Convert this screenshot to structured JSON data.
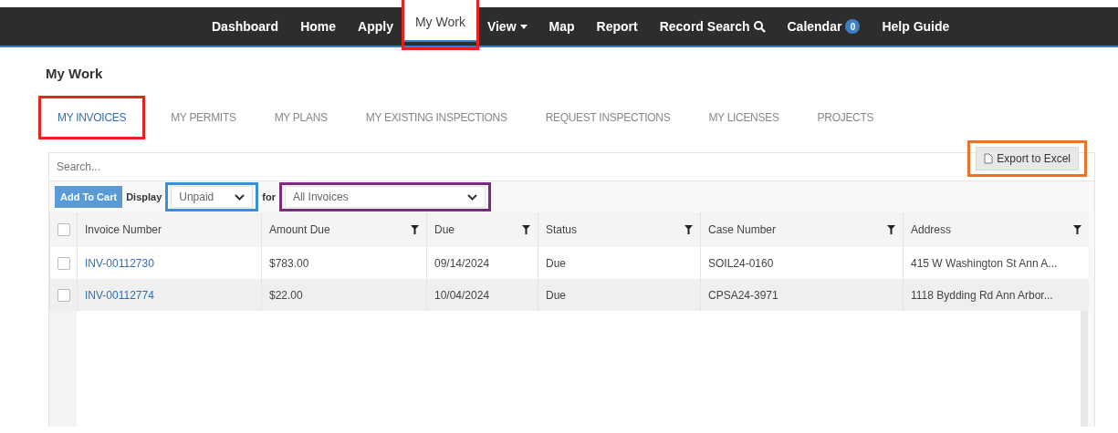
{
  "nav": [
    {
      "label": "Dashboard",
      "selected": false
    },
    {
      "label": "Home",
      "selected": false
    },
    {
      "label": "Apply",
      "selected": false
    },
    {
      "label": "My Work",
      "selected": true,
      "color": "#e8231d"
    },
    {
      "label": "View",
      "selected": false,
      "kind": "dropdown"
    },
    {
      "label": "Map",
      "selected": false
    },
    {
      "label": "Report",
      "selected": false
    },
    {
      "label": "Record Search",
      "selected": false,
      "kind": "search"
    },
    {
      "label": "Calendar",
      "selected": false,
      "kind": "badge",
      "badge": "0"
    },
    {
      "label": "Help Guide",
      "selected": false
    }
  ],
  "page_title": "My Work",
  "tabs": [
    {
      "label": "MY INVOICES",
      "selected": true,
      "color": "#e8231d"
    },
    {
      "label": "MY PERMITS",
      "selected": false
    },
    {
      "label": "MY PLANS",
      "selected": false
    },
    {
      "label": "MY EXISTING INSPECTIONS",
      "selected": false
    },
    {
      "label": "REQUEST INSPECTIONS",
      "selected": false
    },
    {
      "label": "MY LICENSES",
      "selected": false
    },
    {
      "label": "PROJECTS",
      "selected": false
    }
  ],
  "search": {
    "placeholder": "Search..."
  },
  "export_button": {
    "label": "Export to Excel",
    "color": "#e8732b"
  },
  "add_to_cart": "Add To Cart",
  "display_label": "Display",
  "display_select": {
    "value": "Unpaid",
    "color": "#3a8fd9"
  },
  "for_label": "for",
  "for_select": {
    "value": "All Invoices",
    "color": "#7b2a7e"
  },
  "table": {
    "select_all": {
      "checked": false
    },
    "columns": [
      {
        "label": "Invoice Number",
        "filter": false
      },
      {
        "label": "Amount Due",
        "filter": true
      },
      {
        "label": "Due",
        "filter": true
      },
      {
        "label": "Status",
        "filter": true
      },
      {
        "label": "Case Number",
        "filter": true
      },
      {
        "label": "Address",
        "filter": true
      }
    ],
    "rows": [
      {
        "checked": false,
        "cells": [
          "INV-00112730",
          "$783.00",
          "09/14/2024",
          "Due",
          "SOIL24-0160",
          "415 W Washington St Ann A..."
        ]
      },
      {
        "checked": false,
        "cells": [
          "INV-00112774",
          "$22.00",
          "10/04/2024",
          "Due",
          "CPSA24-3971",
          "1118 Bydding Rd Ann Arbor..."
        ]
      }
    ]
  }
}
